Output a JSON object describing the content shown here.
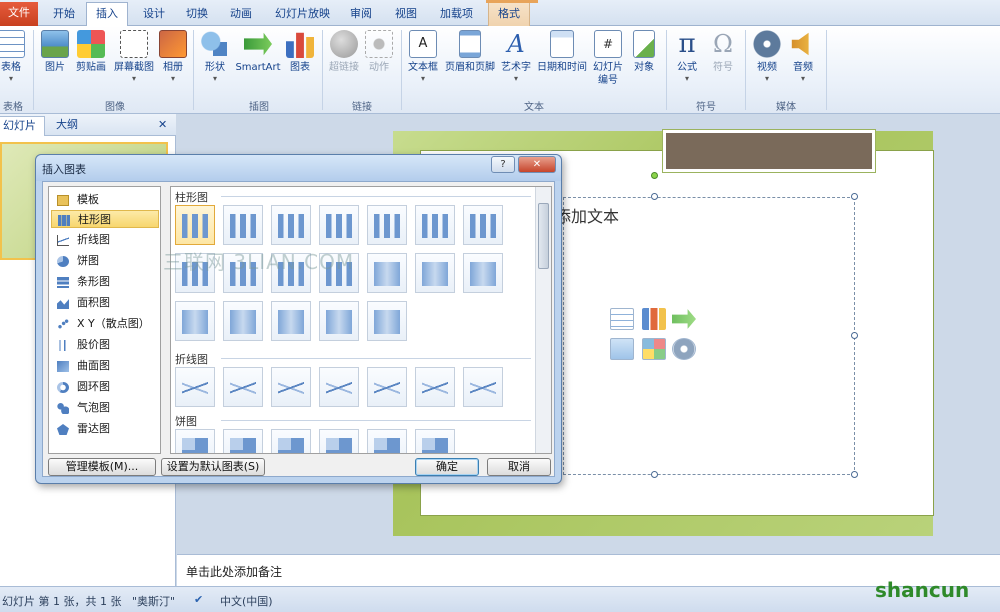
{
  "tabs": [
    "文件",
    "开始",
    "插入",
    "设计",
    "切换",
    "动画",
    "幻灯片放映",
    "审阅",
    "视图",
    "加载项",
    "格式"
  ],
  "ribbon": {
    "groups": [
      "表格",
      "图像",
      "插图",
      "链接",
      "文本",
      "符号",
      "媒体"
    ],
    "buttons": {
      "table": "表格",
      "picture": "图片",
      "clipart": "剪贴画",
      "screenshot": "屏幕截图",
      "album": "相册",
      "shapes": "形状",
      "smartart": "SmartArt",
      "chart": "图表",
      "hyperlink": "超链接",
      "action": "动作",
      "textbox": "文本框",
      "headerfooter": "页眉和页脚",
      "wordart": "艺术字",
      "datetime": "日期和时间",
      "slidenum_1": "幻灯片",
      "slidenum_2": "编号",
      "object": "对象",
      "equation": "公式",
      "symbol": "符号",
      "video": "视频",
      "audio": "音频"
    }
  },
  "leftpane": {
    "tab_slides": "幻灯片",
    "tab_outline": "大纲",
    "close": "✕"
  },
  "slide": {
    "placeholder_text": "添加文本"
  },
  "notes": "单击此处添加备注",
  "status": {
    "slideinfo": "幻灯片 第 1 张，共 1 张",
    "theme": "\"奥斯汀\"",
    "lang": "中文(中国)"
  },
  "dialog": {
    "title": "插入图表",
    "help": "?",
    "close": "✕",
    "categories": [
      "模板",
      "柱形图",
      "折线图",
      "饼图",
      "条形图",
      "面积图",
      "X Y（散点图）",
      "股价图",
      "曲面图",
      "圆环图",
      "气泡图",
      "雷达图"
    ],
    "selected_category": "柱形图",
    "sections": [
      "柱形图",
      "折线图",
      "饼图"
    ],
    "btn_manage": "管理模板(M)...",
    "btn_default": "设置为默认图表(S)",
    "btn_ok": "确定",
    "btn_cancel": "取消"
  },
  "watermark": "三联网 3LIAN.COM",
  "logo": "shancun",
  "colors": {
    "accent": "#f2c24c",
    "file_tab": "#d4502c",
    "slide_green": "#b5cd70"
  }
}
